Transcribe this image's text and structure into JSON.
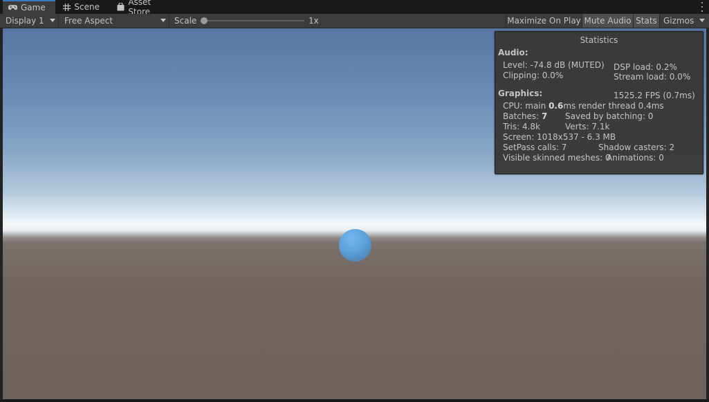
{
  "tabs": [
    {
      "label": "Game",
      "icon": "gamepad-icon",
      "active": true
    },
    {
      "label": "Scene",
      "icon": "grid-icon",
      "active": false
    },
    {
      "label": "Asset Store",
      "icon": "shopping-bag-icon",
      "active": false
    }
  ],
  "toolbar": {
    "display": "Display 1",
    "aspect": "Free Aspect",
    "scale_label": "Scale",
    "scale_value": "1x",
    "scale_slider_fraction": 0.0,
    "maximize_on_play": "Maximize On Play",
    "mute_audio": "Mute Audio",
    "stats": "Stats",
    "gizmos": "Gizmos"
  },
  "colors": {
    "accent": "#3a79bb",
    "panel_bg": "#383838",
    "toolbar_bg": "#3c3c3c",
    "sky_top": "#5976a3",
    "ground": "#6e625e",
    "sphere": "#5ca2dc"
  },
  "statistics": {
    "title": "Statistics",
    "audio_header": "Audio:",
    "level": "Level: -74.8 dB (MUTED)",
    "clipping": "Clipping: 0.0%",
    "dsp_load": "DSP load: 0.2%",
    "stream_load": "Stream load: 0.0%",
    "graphics_header": "Graphics:",
    "fps": "1525.2 FPS (0.7ms)",
    "cpu_prefix": "CPU: main ",
    "cpu_main": "0.6",
    "cpu_suffix": "ms  render thread 0.4ms",
    "batches_prefix": "Batches: ",
    "batches": "7",
    "saved_by_batching": "Saved by batching: 0",
    "tris": "Tris: 4.8k",
    "verts": "Verts: 7.1k",
    "screen": "Screen: 1018x537 - 6.3 MB",
    "setpass": "SetPass calls: 7",
    "shadow_casters": "Shadow casters: 2",
    "skinned": "Visible skinned meshes: 0",
    "animations": "Animations: 0"
  }
}
